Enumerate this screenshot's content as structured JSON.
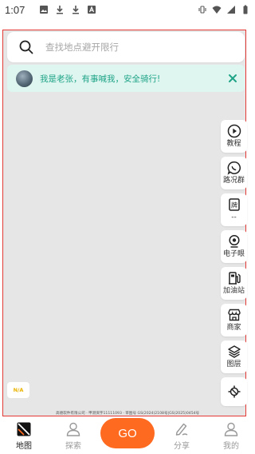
{
  "status_bar": {
    "time": "1:07",
    "icons": [
      "image-icon",
      "download-icon",
      "download-icon",
      "font-icon",
      "vibrate-icon",
      "wifi-icon",
      "signal-icon",
      "battery-icon"
    ]
  },
  "search": {
    "placeholder": "查找地点避开限行"
  },
  "notice": {
    "text": "我是老张，有事喊我，安全骑行!"
  },
  "tools": [
    {
      "label": "教程",
      "icon": "play-icon"
    },
    {
      "label": "路况群",
      "icon": "chat-icon"
    },
    {
      "label": "--",
      "icon": "license-plate-icon"
    },
    {
      "label": "电子眼",
      "icon": "camera-icon"
    },
    {
      "label": "加油站",
      "icon": "fuel-icon"
    },
    {
      "label": "商家",
      "icon": "store-icon"
    },
    {
      "label": "图层",
      "icon": "layers-icon"
    },
    {
      "label": "",
      "icon": "locate-icon"
    }
  ],
  "na_badge": "N/A",
  "credits": "高德软件有限公司 · 甲测资字11111093 · 审图号 GS(2024)2108号|GS(2025)0454号",
  "bottom_nav": {
    "items": [
      {
        "label": "地图",
        "icon": "map-icon",
        "active": true
      },
      {
        "label": "探索",
        "icon": "user-icon",
        "active": false
      },
      {
        "label": "分享",
        "icon": "pen-icon",
        "active": false
      },
      {
        "label": "我的",
        "icon": "profile-icon",
        "active": false
      }
    ],
    "go_label": "GO"
  },
  "colors": {
    "accent": "#ff6a21",
    "notice_bg": "#dff6f0",
    "notice_text": "#1fa487",
    "map_bg": "#e6e6e6",
    "na_text": "#e9b300"
  }
}
